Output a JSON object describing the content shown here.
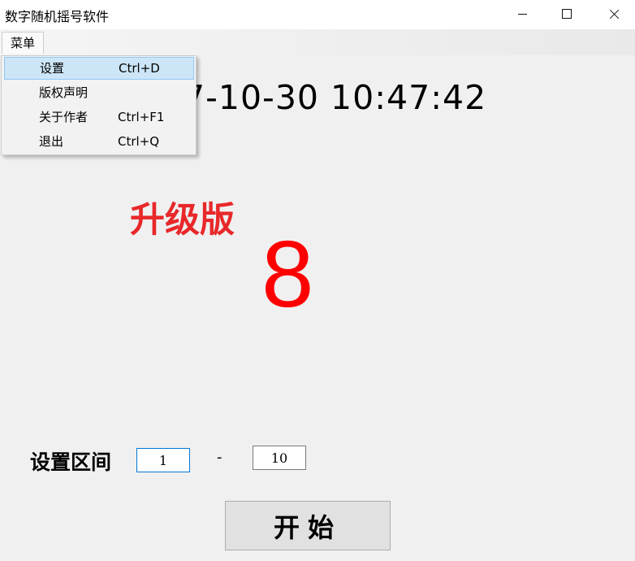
{
  "window": {
    "title": "数字随机摇号软件",
    "controls": [
      "minimize-icon",
      "maximize-icon",
      "close-icon"
    ]
  },
  "menubar": {
    "root_label": "菜单"
  },
  "dropdown": {
    "items": [
      {
        "label": "设置",
        "shortcut": "Ctrl+D",
        "selected": true
      },
      {
        "label": "版权声明",
        "shortcut": ""
      },
      {
        "label": "关于作者",
        "shortcut": "Ctrl+F1"
      },
      {
        "label": "退出",
        "shortcut": "Ctrl+Q"
      }
    ]
  },
  "main": {
    "clock": "7-10-30 10:47:42",
    "edition": "升级版",
    "result": "8"
  },
  "range": {
    "label": "设置区间",
    "min_value": "1",
    "separator": "-",
    "max_value": "10"
  },
  "actions": {
    "start_label": "开始"
  },
  "colors": {
    "result": "#ff0000",
    "edition": "#e8282a",
    "selection_bg": "#cde6f7",
    "selection_border": "#90c8f6",
    "focus_border": "#0078d7"
  }
}
